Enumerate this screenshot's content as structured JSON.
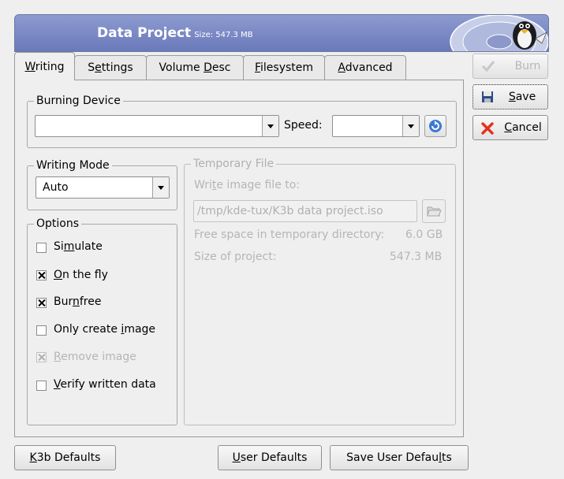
{
  "header": {
    "title": "Data Project",
    "size": "Size: 547.3 MB"
  },
  "tabs": [
    {
      "label_pre": "",
      "label_u": "W",
      "label_post": "riting"
    },
    {
      "label_pre": "S",
      "label_u": "e",
      "label_post": "ttings"
    },
    {
      "label_pre": "Volume ",
      "label_u": "D",
      "label_post": "esc"
    },
    {
      "label_pre": "",
      "label_u": "F",
      "label_post": "ilesystem"
    },
    {
      "label_pre": "",
      "label_u": "A",
      "label_post": "dvanced"
    }
  ],
  "burning_device": {
    "title": "Burning Device",
    "device_value": "",
    "speed_label": "Speed:",
    "speed_value": ""
  },
  "writing_mode": {
    "title": "Writing Mode",
    "value": "Auto"
  },
  "options": {
    "title": "Options",
    "items": [
      {
        "pre": "Si",
        "u": "m",
        "post": "ulate",
        "checked": false,
        "disabled": false
      },
      {
        "pre": "",
        "u": "O",
        "post": "n the fly",
        "checked": true,
        "disabled": false
      },
      {
        "pre": "Bur",
        "u": "n",
        "post": "free",
        "checked": true,
        "disabled": false
      },
      {
        "pre": "Only create ",
        "u": "i",
        "post": "mage",
        "checked": false,
        "disabled": false
      },
      {
        "pre": "",
        "u": "R",
        "post": "emove image",
        "checked": true,
        "disabled": true
      },
      {
        "pre": "",
        "u": "V",
        "post": "erify written data",
        "checked": false,
        "disabled": false
      }
    ]
  },
  "temporary_file": {
    "title": "Temporary File",
    "write_label_pre": "Wri",
    "write_label_u": "t",
    "write_label_post": "e image file to:",
    "path": "/tmp/kde-tux/K3b data project.iso",
    "free_space_label": "Free space in temporary directory:",
    "free_space_value": "6.0 GB",
    "project_size_label": "Size of project:",
    "project_size_value": "547.3 MB"
  },
  "side_buttons": {
    "burn": {
      "label": "Burn"
    },
    "save": {
      "u": "S",
      "post": "ave"
    },
    "cancel": {
      "u": "C",
      "post": "ancel"
    }
  },
  "bottom_buttons": {
    "k3b_defaults": {
      "u": "K",
      "post": "3b Defaults"
    },
    "user_defaults": {
      "u": "U",
      "post": "ser Defaults"
    },
    "save_user_defaults": {
      "pre": "Save User Defau",
      "u": "l",
      "post": "ts"
    }
  },
  "colors": {
    "banner": "#7683c2",
    "cancel_x": "#e5301d",
    "refresh": "#3b79d6"
  },
  "icons": [
    "penguin-cd-logo-icon",
    "refresh-icon",
    "folder-open-icon",
    "checkmark-icon",
    "floppy-save-icon",
    "cancel-x-icon"
  ]
}
